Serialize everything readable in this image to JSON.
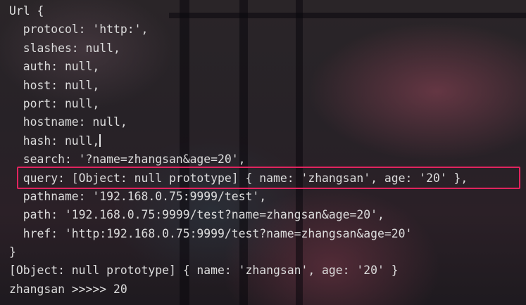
{
  "terminal": {
    "lines": [
      "Url {",
      "  protocol: 'http:',",
      "  slashes: null,",
      "  auth: null,",
      "  host: null,",
      "  port: null,",
      "  hostname: null,",
      "  hash: null,",
      "  search: '?name=zhangsan&age=20',",
      "  query: [Object: null prototype] { name: 'zhangsan', age: '20' },",
      "  pathname: '192.168.0.75:9999/test',",
      "  path: '192.168.0.75:9999/test?name=zhangsan&age=20',",
      "  href: 'http:192.168.0.75:9999/test?name=zhangsan&age=20'",
      "}",
      "[Object: null prototype] { name: 'zhangsan', age: '20' }",
      "zhangsan >>>>> 20"
    ],
    "highlight_color": "#e0245e",
    "text_color": "#dcdcdc"
  }
}
